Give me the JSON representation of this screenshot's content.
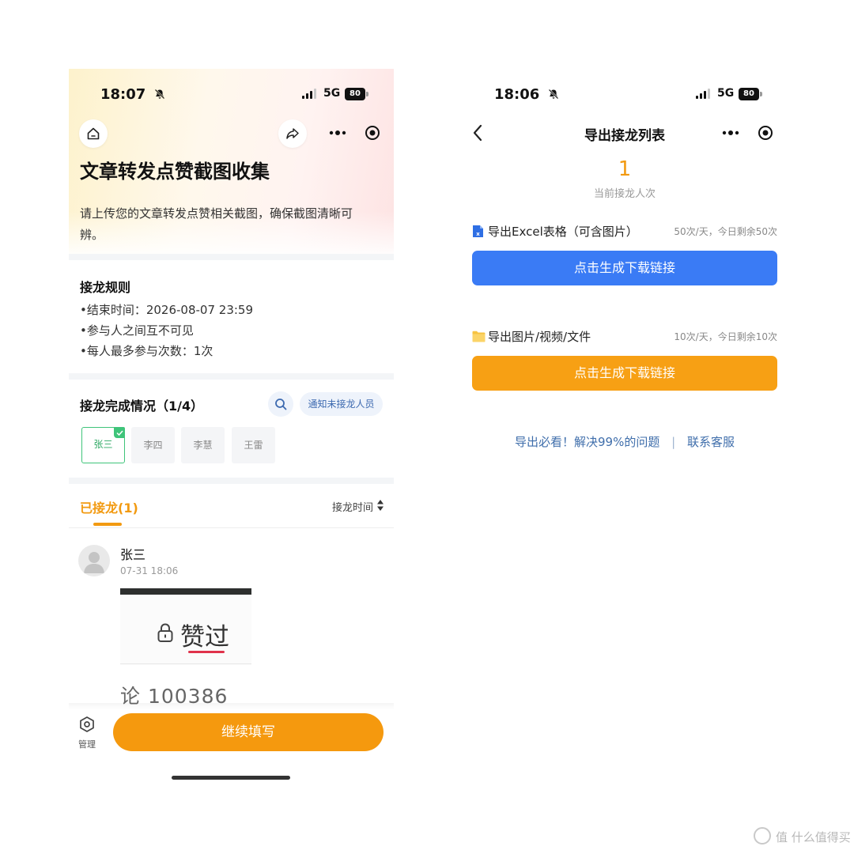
{
  "left": {
    "status": {
      "time": "18:07",
      "network": "5G",
      "battery": "80"
    },
    "title": "文章转发点赞截图收集",
    "description": "请上传您的文章转发点赞相关截图，确保截图清晰可辨。",
    "rules": {
      "heading": "接龙规则",
      "lines": [
        "•结束时间：2026-08-07 23:59",
        "•参与人之间互不可见",
        "•每人最多参与次数：1次"
      ]
    },
    "progress": {
      "heading": "接龙完成情况（1/4）",
      "notify_label": "通知未接龙人员",
      "members": [
        {
          "name": "张三",
          "done": true
        },
        {
          "name": "李四",
          "done": false
        },
        {
          "name": "李慧",
          "done": false
        },
        {
          "name": "王雷",
          "done": false
        }
      ]
    },
    "joined": {
      "tab_label": "已接龙(1)",
      "sort_label": "接龙时间",
      "entry": {
        "name": "张三",
        "time": "07-31 18:06",
        "shot_text": "赞过",
        "shot_number": "论 100386"
      }
    },
    "bottom": {
      "manage_label": "管理",
      "continue_label": "继续填写"
    }
  },
  "right": {
    "status": {
      "time": "18:06",
      "network": "5G",
      "battery": "80"
    },
    "nav_title": "导出接龙列表",
    "count": "1",
    "count_label": "当前接龙人次",
    "excel": {
      "label": "导出Excel表格（可含图片）",
      "quota": "50次/天，今日剩余50次",
      "button": "点击生成下载链接"
    },
    "files": {
      "label": "导出图片/视频/文件",
      "quota": "10次/天，今日剩余10次",
      "button": "点击生成下载链接"
    },
    "footer": {
      "help": "导出必看！解决99%的问题",
      "sep": "|",
      "contact": "联系客服"
    }
  },
  "watermark": {
    "text": "值 什么值得买"
  },
  "colors": {
    "accent_orange": "#f5990e",
    "accent_blue": "#3a7bf5",
    "done_green": "#3fc47a",
    "link_blue": "#3f6eab"
  },
  "icons": [
    "home-icon",
    "share-icon",
    "more-dots-icon",
    "target-icon",
    "search-icon",
    "check-icon",
    "sort-icon",
    "avatar-icon",
    "lock-icon",
    "hexagon-gear-icon",
    "back-icon",
    "excel-icon",
    "folder-icon",
    "bell-mute-icon",
    "signal-icon"
  ]
}
